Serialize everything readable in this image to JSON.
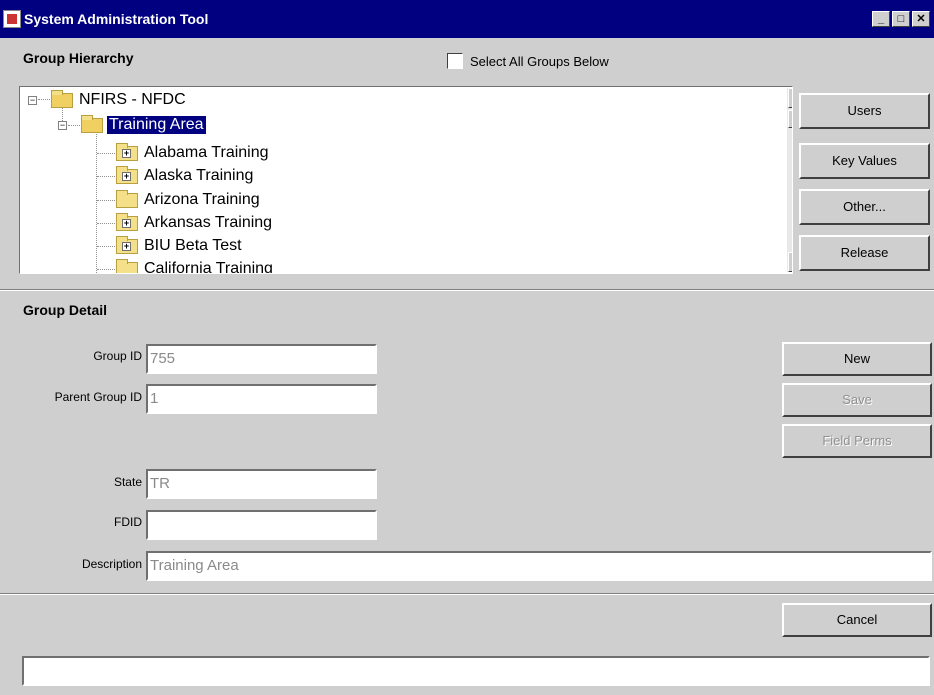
{
  "window": {
    "title": "System Administration Tool",
    "controls": [
      "minimize",
      "maximize",
      "close"
    ],
    "control_glyphs": [
      "_",
      "□",
      "✕"
    ]
  },
  "hierarchy": {
    "title": "Group Hierarchy",
    "select_all_label": "Select All Groups Below",
    "select_all_checked": false,
    "tree": [
      {
        "label": "NFIRS - NFDC",
        "level": 0,
        "expanded": true,
        "selected": false
      },
      {
        "label": "Training Area",
        "level": 1,
        "expanded": true,
        "selected": true
      },
      {
        "label": "Alabama Training",
        "level": 2,
        "has_children": true
      },
      {
        "label": "Alaska Training",
        "level": 2,
        "has_children": true
      },
      {
        "label": "Arizona Training",
        "level": 2,
        "has_children": false
      },
      {
        "label": "Arkansas Training",
        "level": 2,
        "has_children": true
      },
      {
        "label": "BIU Beta Test",
        "level": 2,
        "has_children": true
      },
      {
        "label": "California Training",
        "level": 2,
        "has_children": false
      }
    ],
    "side_buttons": [
      "Users",
      "Key Values",
      "Other...",
      "Release"
    ]
  },
  "detail": {
    "title": "Group Detail",
    "fields": {
      "group_id": {
        "label": "Group ID",
        "value": "755"
      },
      "parent_group_id": {
        "label": "Parent Group ID",
        "value": "1"
      },
      "state": {
        "label": "State",
        "value": "TR"
      },
      "fdid": {
        "label": "FDID",
        "value": ""
      },
      "description": {
        "label": "Description",
        "value": "Training Area"
      }
    },
    "buttons": {
      "new": {
        "label": "New",
        "enabled": true
      },
      "save": {
        "label": "Save",
        "enabled": false
      },
      "field_perms": {
        "label": "Field Perms",
        "enabled": false
      }
    }
  },
  "footer": {
    "cancel_label": "Cancel",
    "status_text": ""
  },
  "colors": {
    "title_bar": "#000080",
    "selection": "#000080",
    "background": "#cfcfcf",
    "folder": "#f5e08a"
  }
}
